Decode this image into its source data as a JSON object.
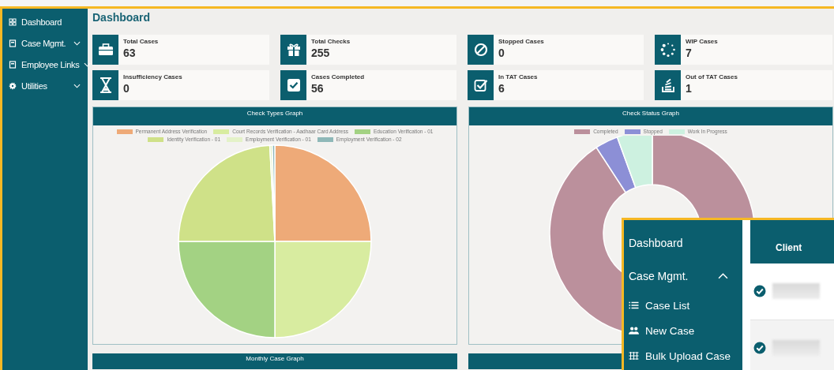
{
  "sidebar": {
    "items": [
      {
        "label": "Dashboard",
        "kind": "link"
      },
      {
        "label": "Case Mgmt.",
        "kind": "menu"
      },
      {
        "label": "Employee Links",
        "kind": "menu"
      },
      {
        "label": "Utilities",
        "kind": "menu"
      }
    ]
  },
  "page_title": "Dashboard",
  "stats": [
    {
      "label": "Total Cases",
      "value": "63"
    },
    {
      "label": "Total Checks",
      "value": "255"
    },
    {
      "label": "Stopped Cases",
      "value": "0"
    },
    {
      "label": "WIP Cases",
      "value": "7"
    },
    {
      "label": "Insufficiency Cases",
      "value": "0"
    },
    {
      "label": "Cases Completed",
      "value": "56"
    },
    {
      "label": "In TAT Cases",
      "value": "6"
    },
    {
      "label": "Out of TAT Cases",
      "value": "1"
    }
  ],
  "charts": [
    {
      "title": "Check Types Graph",
      "kind": "pie",
      "legend": [
        {
          "label": "Permanent Address Verification",
          "color": "#eeaa78"
        },
        {
          "label": "Court Records Verification - Aadhaar Card Address",
          "color": "#d8eca0"
        },
        {
          "label": "Education Verification - 01",
          "color": "#a3d283"
        },
        {
          "label": "Identity Verification - 01",
          "color": "#cfe188"
        },
        {
          "label": "Employment Verification - 01",
          "color": "#e4f2c8"
        },
        {
          "label": "Employment Verification - 02",
          "color": "#8fb8b8"
        }
      ]
    },
    {
      "title": "Check Status Graph",
      "kind": "donut",
      "legend": [
        {
          "label": "Completed",
          "color": "#bb909c"
        },
        {
          "label": "Stopped",
          "color": "#8c8fd6"
        },
        {
          "label": "Work In Progress",
          "color": "#cdf1e0"
        }
      ]
    }
  ],
  "bottom_panel": {
    "title": "Monthly Case Graph"
  },
  "inset": {
    "menu": [
      {
        "label": "Dashboard",
        "kind": "link"
      },
      {
        "label": "Case Mgmt.",
        "kind": "menu",
        "children": [
          {
            "label": "Case List"
          },
          {
            "label": "New Case"
          },
          {
            "label": "Bulk Upload Case"
          }
        ]
      }
    ],
    "table": {
      "columns": [
        "Client"
      ],
      "rows": [
        {
          "checked": true
        },
        {
          "checked": true
        }
      ]
    }
  }
}
